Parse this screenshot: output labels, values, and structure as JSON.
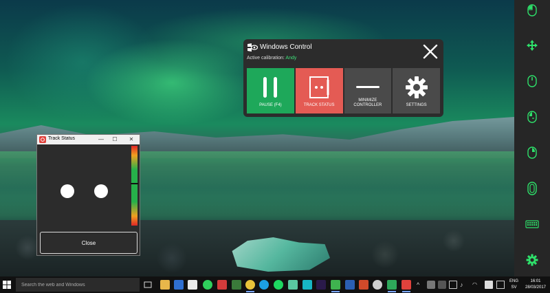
{
  "windows_control": {
    "title": "Windows Control",
    "calibration_label": "Active calibration:",
    "calibration_name": "Andy",
    "tiles": [
      {
        "label": "PAUSE (F4)",
        "icon": "pause-icon",
        "color": "#1ea85a"
      },
      {
        "label": "TRACK STATUS",
        "icon": "track-status-icon",
        "color": "#e45b54"
      },
      {
        "label_line1": "MINIMIZE",
        "label_line2": "CONTROLLER",
        "icon": "minimize-icon",
        "color": "#4a4a4a"
      },
      {
        "label": "SETTINGS",
        "icon": "gear-icon",
        "color": "#4a4a4a"
      }
    ],
    "accent": "#3ee07a"
  },
  "track_status": {
    "title": "Track Status",
    "close_label": "Close",
    "minimize_glyph": "—",
    "maximize_glyph": "☐",
    "close_glyph": "✕"
  },
  "sidebar": {
    "icons": [
      "left-click-icon",
      "move-icon",
      "scroll-mouse-icon",
      "double-click-icon",
      "right-click-icon",
      "drag-icon",
      "keyboard-icon",
      "settings-icon"
    ],
    "accent": "#2ee06a"
  },
  "taskbar": {
    "search_placeholder": "Search the web and Windows",
    "lang_1": "ENG",
    "lang_2": "SV",
    "time": "16:01",
    "date": "28/03/2017"
  }
}
